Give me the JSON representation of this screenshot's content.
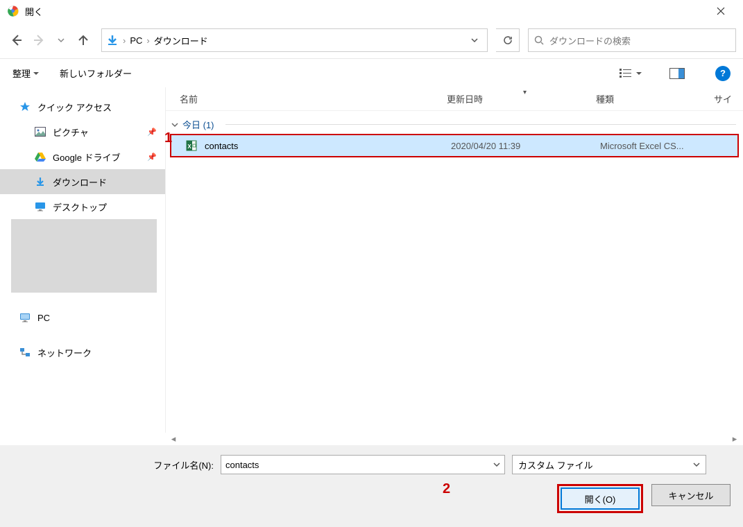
{
  "window": {
    "title": "開く"
  },
  "breadcrumb": {
    "segments": [
      "PC",
      "ダウンロード"
    ]
  },
  "search": {
    "placeholder": "ダウンロードの検索"
  },
  "toolbar": {
    "organize": "整理",
    "newfolder": "新しいフォルダー"
  },
  "sidebar": {
    "quickaccess": "クイック アクセス",
    "pictures": "ピクチャ",
    "gdrive": "Google ドライブ",
    "downloads": "ダウンロード",
    "desktop": "デスクトップ",
    "pc": "PC",
    "network": "ネットワーク"
  },
  "columns": {
    "name": "名前",
    "date": "更新日時",
    "type": "種類",
    "size": "サイ"
  },
  "group": {
    "today": "今日 (1)"
  },
  "file": {
    "name": "contacts",
    "date": "2020/04/20 11:39",
    "type": "Microsoft Excel CS..."
  },
  "filename": {
    "label": "ファイル名(N):",
    "value": "contacts"
  },
  "filter": {
    "value": "カスタム ファイル"
  },
  "buttons": {
    "open": "開く(O)",
    "cancel": "キャンセル"
  },
  "annotations": {
    "one": "1",
    "two": "2"
  }
}
